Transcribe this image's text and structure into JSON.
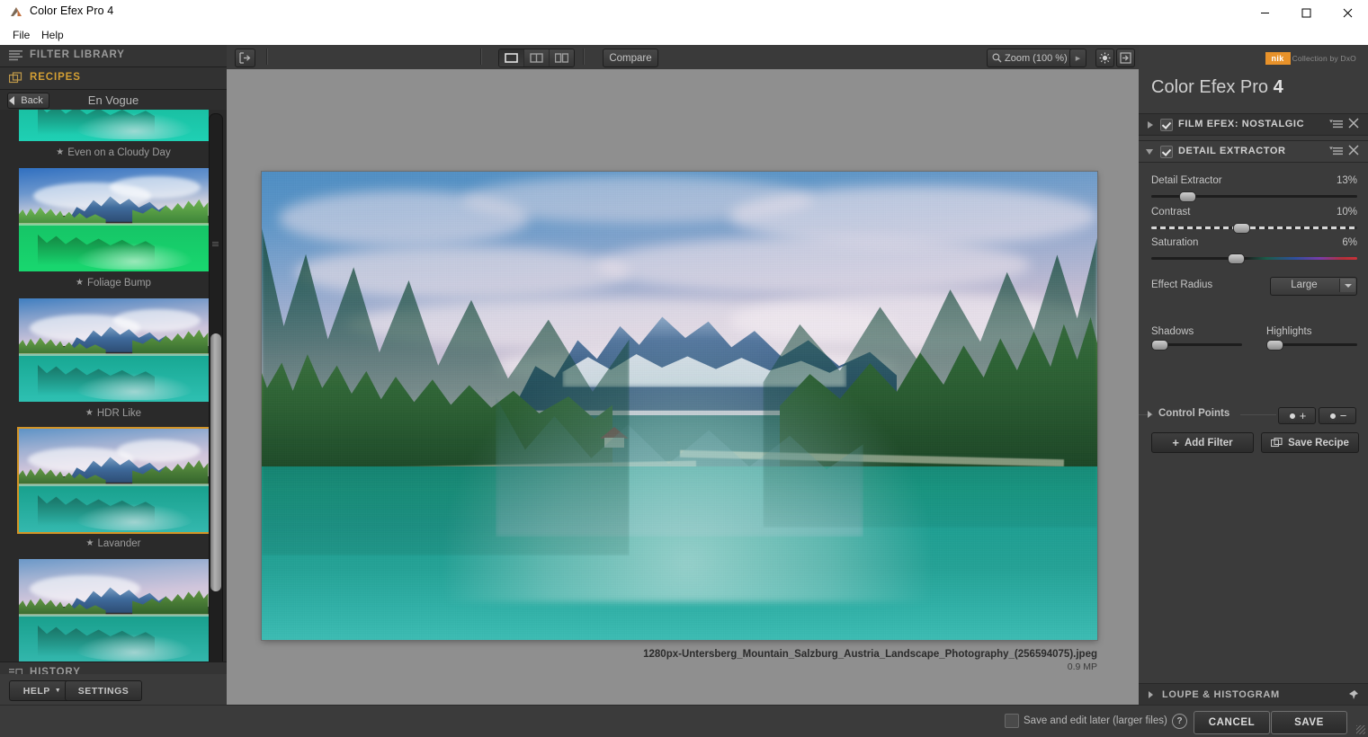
{
  "window": {
    "title": "Color Efex Pro 4",
    "app_icon": "color-efex-logo-icon",
    "minimize": "–",
    "maximize": "□",
    "close": "✕"
  },
  "menubar": {
    "items": [
      "File",
      "Help"
    ]
  },
  "left_panel": {
    "filter_library": {
      "label": "FILTER LIBRARY",
      "icon": "list-lines-icon"
    },
    "recipes": {
      "label": "RECIPES",
      "icon": "stacked-cards-icon",
      "active": true
    },
    "nav": {
      "back_label": "Back",
      "category_title": "En Vogue"
    },
    "recipes_list": [
      {
        "label": "Even on a Cloudy Day",
        "favorite": true,
        "selected": false
      },
      {
        "label": "Foliage Bump",
        "favorite": true,
        "selected": false
      },
      {
        "label": "HDR Like",
        "favorite": true,
        "selected": false
      },
      {
        "label": "Lavander",
        "favorite": true,
        "selected": true
      },
      {
        "label": "",
        "favorite": false,
        "selected": false
      }
    ],
    "history": {
      "label": "HISTORY",
      "icon": "history-icon"
    },
    "help_button": "HELP",
    "settings_button": "SETTINGS"
  },
  "toolbar": {
    "export_icon": "export-arrow-icon",
    "view_single_icon": "single-view-icon",
    "view_split_icon": "split-view-icon",
    "view_side_icon": "side-by-side-icon",
    "compare_label": "Compare",
    "zoom_label": "Zoom (100 %)",
    "zoom_icon": "magnifier-icon",
    "zoom_arrow": "▶",
    "brightness_icon": "brightness-icon",
    "fullscreen_icon": "fullscreen-icon"
  },
  "canvas": {
    "file_name": "1280px-Untersberg_Mountain_Salzburg_Austria_Landscape_Photography_(256594075).jpeg",
    "file_size": "0.9 MP"
  },
  "right_panel": {
    "brand_badge": {
      "mark": "nik",
      "tagline": "Collection by DxO",
      "color": "#e8922a"
    },
    "brand_name": "Color Efex Pro",
    "brand_version": "4",
    "filters": [
      {
        "name": "FILM EFEX: NOSTALGIC",
        "enabled": true,
        "expanded": false
      },
      {
        "name": "DETAIL EXTRACTOR",
        "enabled": true,
        "expanded": true
      }
    ],
    "sliders": [
      {
        "label": "Detail Extractor",
        "value": "13%",
        "percent": 13,
        "style": "plain"
      },
      {
        "label": "Contrast",
        "value": "10%",
        "percent": 50,
        "style": "dashed"
      },
      {
        "label": "Saturation",
        "value": "6%",
        "percent": 47,
        "style": "gradient"
      }
    ],
    "effect_radius": {
      "label": "Effect Radius",
      "value": "Large"
    },
    "tone_sliders": [
      {
        "label": "Shadows",
        "percent": 2
      },
      {
        "label": "Highlights",
        "percent": 2
      }
    ],
    "control_points": {
      "label": "Control Points",
      "add_icon": "add-control-point-icon",
      "remove_icon": "remove-control-point-icon"
    },
    "add_filter_button": "Add Filter",
    "save_recipe_button": "Save Recipe",
    "loupe_histogram": {
      "label": "LOUPE & HISTOGRAM",
      "pin_icon": "pin-icon"
    }
  },
  "bottom_bar": {
    "save_later_checkbox": {
      "label": "Save and edit later (larger files)",
      "checked": false
    },
    "help_icon": "question-mark-icon",
    "cancel_button": "CANCEL",
    "save_button": "SAVE"
  }
}
